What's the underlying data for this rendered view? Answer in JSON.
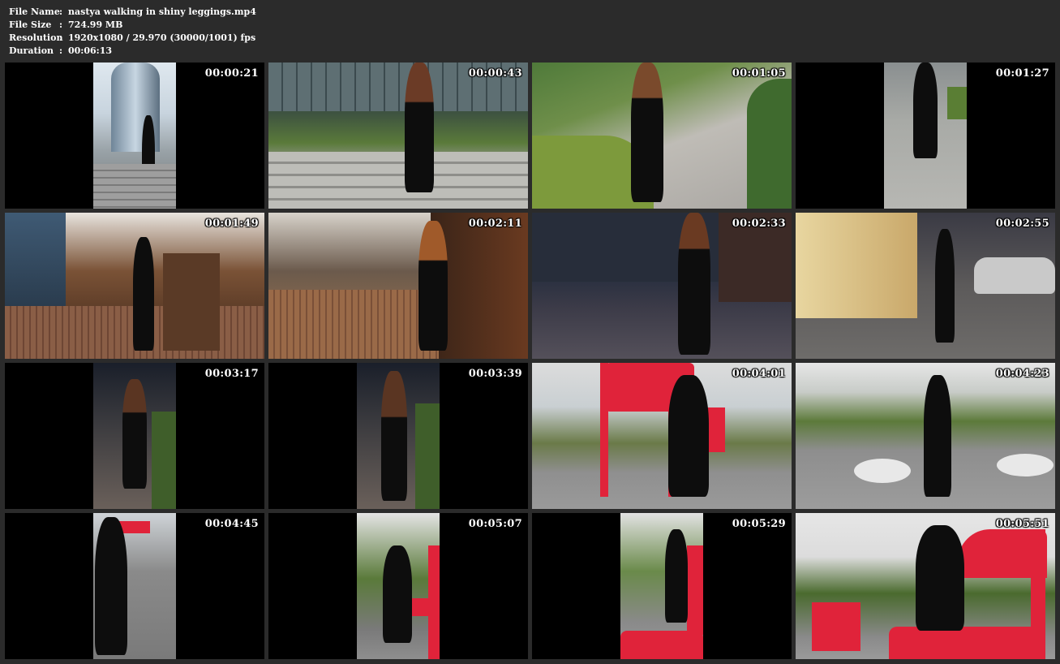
{
  "meta": {
    "rows": [
      {
        "key": "File Name",
        "sep": ":",
        "value": "nastya walking in shiny leggings.mp4"
      },
      {
        "key": "File Size",
        "sep": ":",
        "value": "724.99 MB"
      },
      {
        "key": "Resolution",
        "sep": ":",
        "value": "1920x1080 / 29.970 (30000/1001) fps"
      },
      {
        "key": "Duration",
        "sep": ":",
        "value": "00:06:13"
      }
    ]
  },
  "thumbnails": [
    {
      "timestamp": "00:00:21"
    },
    {
      "timestamp": "00:00:43"
    },
    {
      "timestamp": "00:01:05"
    },
    {
      "timestamp": "00:01:27"
    },
    {
      "timestamp": "00:01:49"
    },
    {
      "timestamp": "00:02:11"
    },
    {
      "timestamp": "00:02:33"
    },
    {
      "timestamp": "00:02:55"
    },
    {
      "timestamp": "00:03:17"
    },
    {
      "timestamp": "00:03:39"
    },
    {
      "timestamp": "00:04:01"
    },
    {
      "timestamp": "00:04:23"
    },
    {
      "timestamp": "00:04:45"
    },
    {
      "timestamp": "00:05:07"
    },
    {
      "timestamp": "00:05:29"
    },
    {
      "timestamp": "00:05:51"
    }
  ]
}
